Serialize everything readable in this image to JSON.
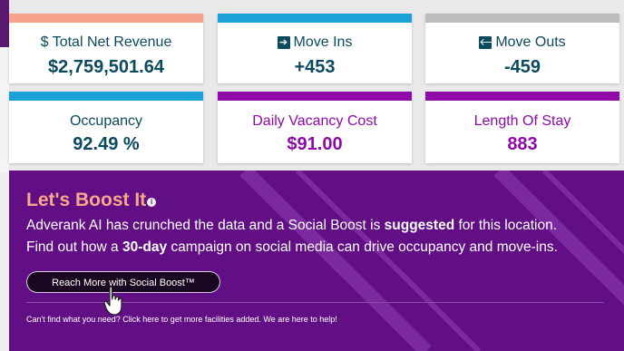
{
  "metrics": [
    {
      "label": "$ Total Net Revenue",
      "value": "$2,759,501.64",
      "bar_color": "#f6a28c",
      "text_color": "#0c4a5e",
      "icon": ""
    },
    {
      "label": "Move Ins",
      "value": "+453",
      "bar_color": "#1ba1d8",
      "text_color": "#0c4a5e",
      "icon": "arrow-right-icon"
    },
    {
      "label": "Move Outs",
      "value": "-459",
      "bar_color": "#bdbdbd",
      "text_color": "#0c4a5e",
      "icon": "arrow-left-icon"
    },
    {
      "label": "Occupancy",
      "value": "92.49 %",
      "bar_color": "#1ba1d8",
      "text_color": "#0c4a5e",
      "icon": ""
    },
    {
      "label": "Daily Vacancy Cost",
      "value": "$91.00",
      "bar_color": "#8e0ba8",
      "text_color": "#8e0ba8",
      "icon": ""
    },
    {
      "label": "Length Of Stay",
      "value": "883",
      "bar_color": "#8e0ba8",
      "text_color": "#8e0ba8",
      "icon": ""
    }
  ],
  "boost": {
    "title": "Let's Boost It",
    "line1_pre": "Adverank AI has crunched the data and a Social Boost is ",
    "line1_bold": "suggested",
    "line1_post": " for this location.",
    "line2_pre": "Find out how a ",
    "line2_bold": "30-day",
    "line2_post": " campaign on social media can drive occupancy and move-ins.",
    "button_label": "Reach More with Social Boost™",
    "help_text": "Can't find what you need? Click here to get more facilities added. We are here to help!",
    "background_color": "#620f86",
    "title_color": "#f7a88a"
  }
}
